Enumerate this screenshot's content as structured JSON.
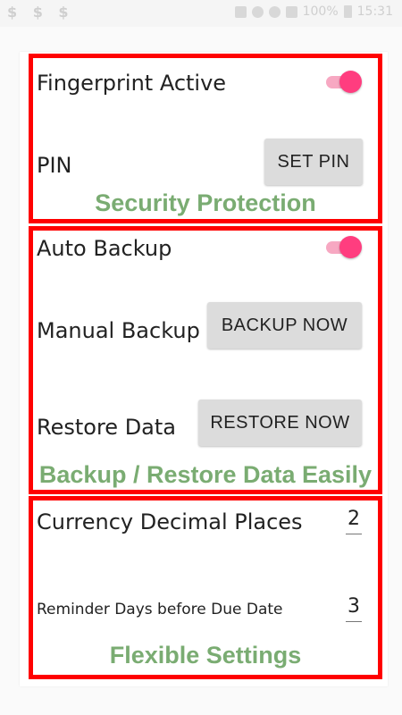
{
  "status_bar": {
    "left_icons": "$ $ $",
    "battery_text": "100%",
    "time": "15:31"
  },
  "security": {
    "fingerprint_label": "Fingerprint Active",
    "fingerprint_on": true,
    "pin_label": "PIN",
    "set_pin_button": "SET PIN",
    "caption": "Security Protection"
  },
  "backup": {
    "auto_backup_label": "Auto Backup",
    "auto_backup_on": true,
    "manual_backup_label": "Manual Backup",
    "backup_now_button": "BACKUP NOW",
    "restore_label": "Restore Data",
    "restore_now_button": "RESTORE NOW",
    "caption": "Backup / Restore Data Easily"
  },
  "settings": {
    "decimal_places_label": "Currency Decimal Places",
    "decimal_places_value": "2",
    "reminder_label": "Reminder Days before Due Date",
    "reminder_value": "3",
    "caption": "Flexible Settings"
  },
  "colors": {
    "highlight_border": "#ff0000",
    "caption_text": "#7aac72",
    "toggle_thumb": "#ff3d7f",
    "toggle_track": "#f7a8c2",
    "button_bg": "#dcdcdc"
  }
}
